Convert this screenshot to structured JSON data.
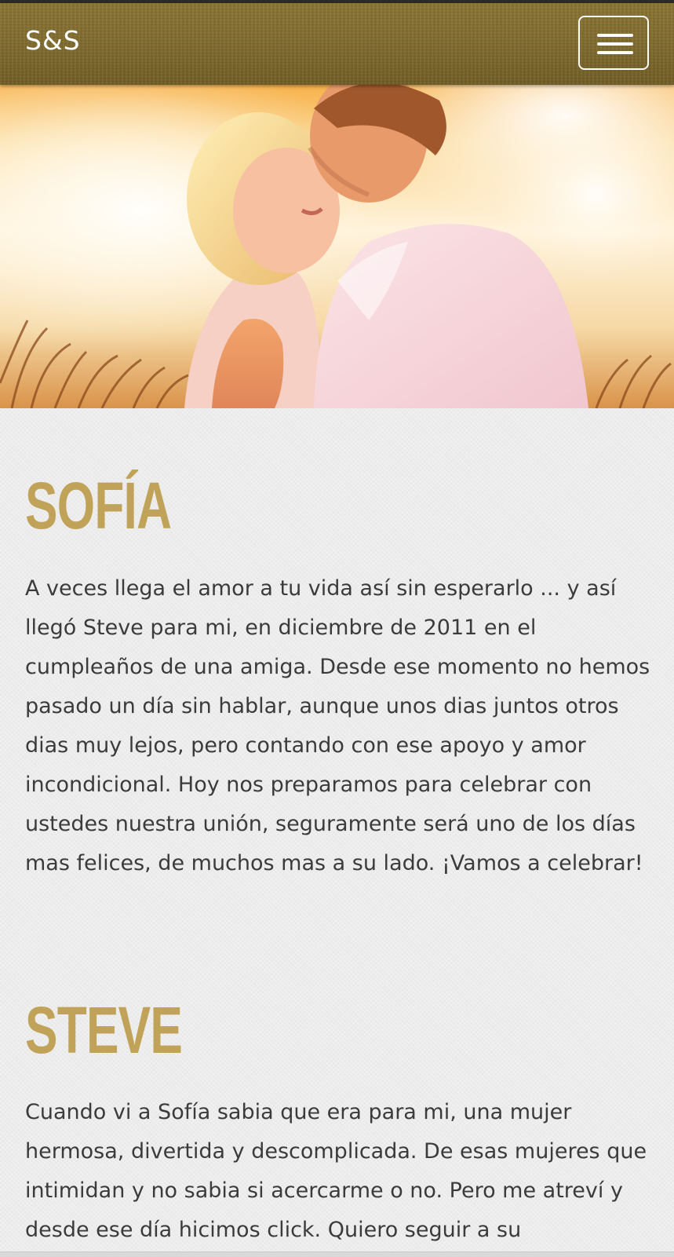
{
  "navbar": {
    "brand": "S&S",
    "menu_icon": "hamburger-menu-icon"
  },
  "hero": {
    "image_subject": "couple embracing at sunset"
  },
  "sections": [
    {
      "title": "SOFÍA",
      "text": "A veces llega el amor a tu vida así sin esperarlo ... y así llegó Steve para mi, en diciembre de 2011 en el cumpleaños de una amiga. Desde ese momento no hemos pasado un día sin hablar, aunque unos dias juntos otros dias muy lejos, pero contando con ese apoyo y amor incondicional. Hoy nos preparamos para celebrar con ustedes nuestra unión, seguramente será uno de los días mas felices, de muchos mas a su lado. ¡Vamos a celebrar!"
    },
    {
      "title": "STEVE",
      "text": "Cuando vi a Sofía sabia que era para mi, una mujer hermosa, divertida y descomplicada. De esas mujeres que intimidan y no sabia si acercarme o no. Pero me atreví y desde ese día hicimos click. Quiero seguir a su"
    }
  ],
  "colors": {
    "navbar": "#7f6a2d",
    "title_gold": "#c0a358",
    "body_text": "#3b3b3b",
    "page_background": "#ececec"
  }
}
